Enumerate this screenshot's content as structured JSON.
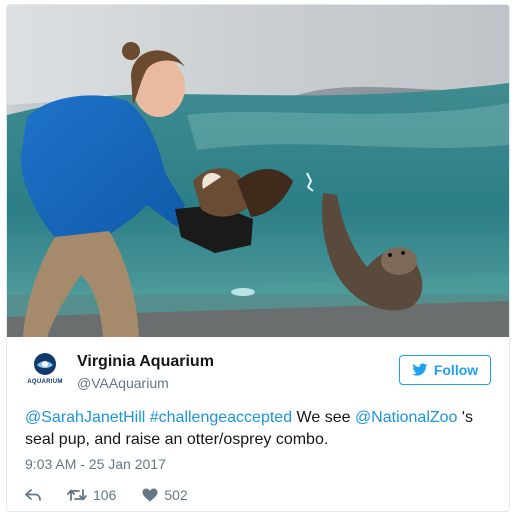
{
  "photo": {
    "description_icon": "aquarium-photo"
  },
  "account": {
    "name": "Virginia Aquarium",
    "handle": "@VAAquarium",
    "avatar_text": "AQUARIUM"
  },
  "follow_button": {
    "label": "Follow",
    "icon": "bird-icon"
  },
  "tweet": {
    "mention1": "@SarahJanetHill",
    "hashtag": "#challengeaccepted",
    "text1": " We see ",
    "mention2": "@NationalZoo",
    "text2": " 's seal pup, and raise an otter/osprey combo.",
    "timestamp": "9:03 AM - 25 Jan 2017"
  },
  "actions": {
    "reply_icon": "reply-icon",
    "retweet_icon": "retweet-icon",
    "retweet_count": "106",
    "like_icon": "heart-icon",
    "like_count": "502"
  },
  "colors": {
    "accent": "#1da1f2",
    "link": "#1b95e0",
    "muted": "#657786"
  }
}
